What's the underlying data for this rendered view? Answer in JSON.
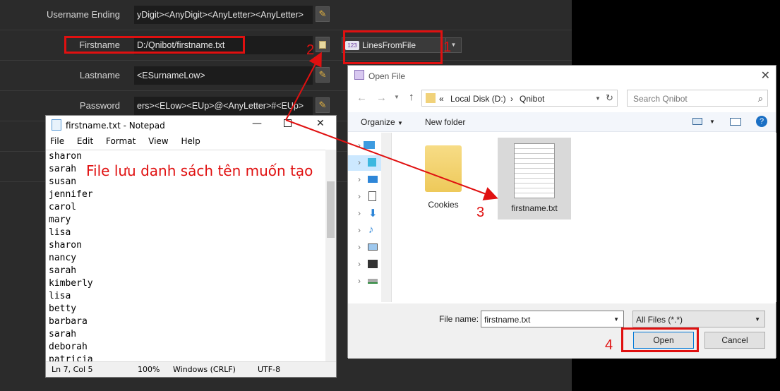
{
  "fields": {
    "username_ending": {
      "label": "Username Ending",
      "value": "yDigit><AnyDigit><AnyLetter><AnyLetter>"
    },
    "firstname": {
      "label": "Firstname",
      "value": "D:/Qnibot/firstname.txt"
    },
    "lastname": {
      "label": "Lastname",
      "value": "<ESurnameLow>"
    },
    "password": {
      "label": "Password",
      "value": "ers><ELow><EUp>@<AnyLetter>#<EUp>"
    }
  },
  "source_dropdown": {
    "badge": "123",
    "value": "LinesFromFile"
  },
  "annotations": {
    "step1": "1",
    "step2": "2",
    "step3": "3",
    "step4": "4",
    "note": "File lưu danh sách tên muốn tạo",
    "accent": "#e01010"
  },
  "notepad": {
    "title": "firstname.txt - Notepad",
    "menu": [
      "File",
      "Edit",
      "Format",
      "View",
      "Help"
    ],
    "lines": [
      "sharon",
      "sarah",
      "susan",
      "jennifer",
      "carol",
      "mary",
      "lisa",
      "sharon",
      "nancy",
      "sarah",
      "kimberly",
      "lisa",
      "betty",
      "barbara",
      "sarah",
      "deborah",
      "patricia"
    ],
    "status": {
      "position": "Ln 7, Col 5",
      "zoom": "100%",
      "eol": "Windows (CRLF)",
      "encoding": "UTF-8"
    }
  },
  "dialog": {
    "title": "Open File",
    "address": {
      "prefix": "«",
      "disk": "Local Disk (D:)",
      "folder": "Qnibot"
    },
    "search_placeholder": "Search Qnibot",
    "toolbar": {
      "organize": "Organize",
      "new_folder": "New folder"
    },
    "items": [
      {
        "name": "Cookies",
        "type": "folder"
      },
      {
        "name": "firstname.txt",
        "type": "file"
      }
    ],
    "filename_label": "File name:",
    "filename_value": "firstname.txt",
    "filter": "All Files (*.*)",
    "open": "Open",
    "cancel": "Cancel"
  }
}
